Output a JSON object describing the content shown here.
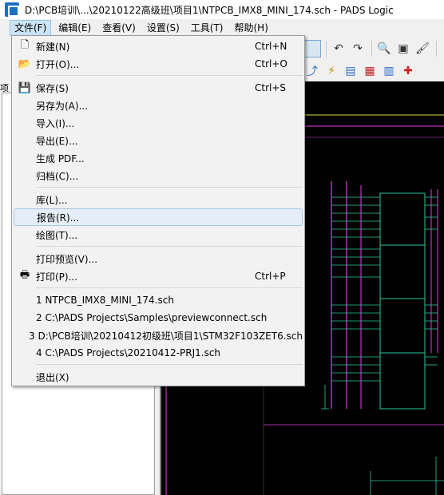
{
  "window": {
    "title": "D:\\PCB培训\\...\\20210122高级班\\项目1\\NTPCB_IMX8_MINI_174.sch - PADS Logic"
  },
  "menubar": [
    {
      "label": "文件(F)"
    },
    {
      "label": "编辑(E)"
    },
    {
      "label": "查看(V)"
    },
    {
      "label": "设置(S)"
    },
    {
      "label": "工具(T)"
    },
    {
      "label": "帮助(H)"
    }
  ],
  "file_menu": {
    "new": {
      "label": "新建(N)",
      "shortcut": "Ctrl+N"
    },
    "open": {
      "label": "打开(O)...",
      "shortcut": "Ctrl+O"
    },
    "save": {
      "label": "保存(S)",
      "shortcut": "Ctrl+S"
    },
    "save_as": {
      "label": "另存为(A)..."
    },
    "import": {
      "label": "导入(I)..."
    },
    "export": {
      "label": "导出(E)..."
    },
    "gen_pdf": {
      "label": "生成 PDF..."
    },
    "archive": {
      "label": "归档(C)..."
    },
    "library": {
      "label": "库(L)..."
    },
    "report": {
      "label": "报告(R)..."
    },
    "plot": {
      "label": "绘图(T)..."
    },
    "print_preview": {
      "label": "打印预览(V)..."
    },
    "print": {
      "label": "打印(P)...",
      "shortcut": "Ctrl+P"
    },
    "recent": [
      "1 NTPCB_IMX8_MINI_174.sch",
      "2 C:\\PADS Projects\\Samples\\previewconnect.sch",
      "3 D:\\PCB培训\\20210412初级班\\项目1\\STM32F103ZET6.sch",
      "4 C:\\PADS Projects\\20210412-PRJ1.sch"
    ],
    "exit": {
      "label": "退出(X)"
    }
  },
  "left_panel": {
    "tab_label": "项"
  },
  "colors": {
    "menu_highlight": "#e5eef8",
    "canvas_bg": "#000000",
    "net_magenta": "#e040e0",
    "wire_green": "#2ec4a0",
    "title_yellow": "#e0e040"
  }
}
